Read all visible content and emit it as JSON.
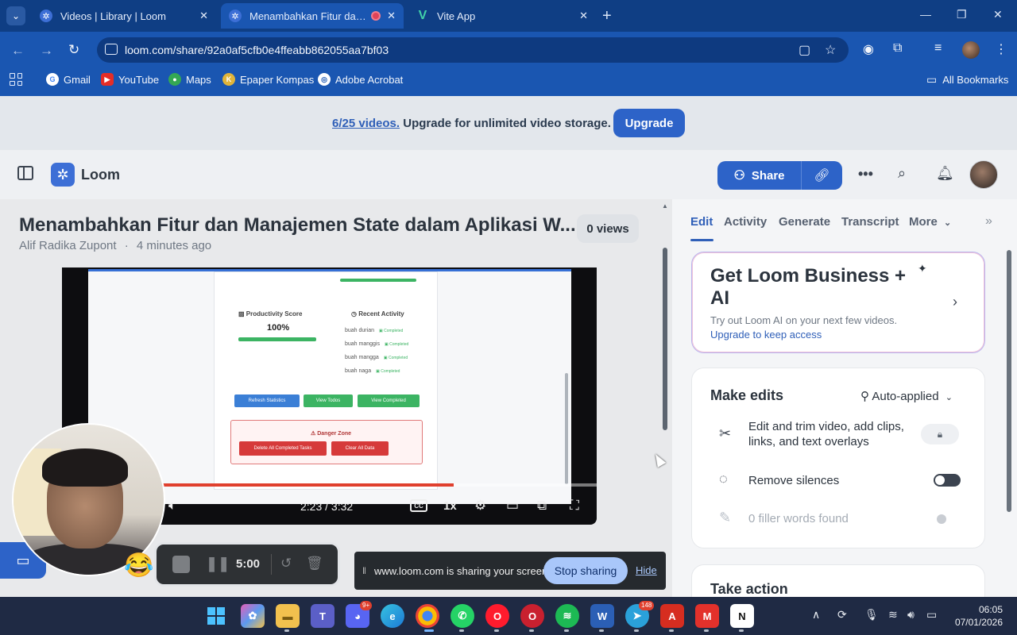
{
  "browser": {
    "tabs": [
      {
        "title": "Videos | Library | Loom",
        "active": false
      },
      {
        "title": "Menambahkan Fitur dan M",
        "active": true
      },
      {
        "title": "Vite App",
        "active": false
      }
    ],
    "url": "loom.com/share/92a0af5cfb0e4ffeabb862055aa7bf03",
    "bookmarks": [
      "Gmail",
      "YouTube",
      "Maps",
      "Epaper Kompas",
      "Adobe Acrobat"
    ],
    "all_bookmarks": "All Bookmarks"
  },
  "banner": {
    "link_text": "6/25 videos.",
    "text": "Upgrade for unlimited video storage.",
    "button": "Upgrade"
  },
  "header": {
    "logo": "Loom",
    "share_label": "Share"
  },
  "video": {
    "title": "Menambahkan Fitur dan Manajemen State dalam Aplikasi W...",
    "author": "Alif Radika Zupont",
    "age": "4 minutes ago",
    "views": "0 views",
    "time_display": "2:23 / 3:32",
    "progress": 0.674,
    "speed": "1x",
    "cc_label": "CC",
    "content": {
      "productivity_title": "Productivity Score",
      "productivity_value": "100%",
      "recent_title": "Recent Activity",
      "recent_items": [
        "buah durian",
        "buah manggis",
        "buah mangga",
        "buah naga"
      ],
      "recent_status": "Completed",
      "buttons": [
        "Refresh Statistics",
        "View Todos",
        "View Completed"
      ],
      "danger_title": "Danger Zone",
      "danger_buttons": [
        "Delete All Completed Tasks",
        "Clear All Data"
      ]
    }
  },
  "recorder": {
    "time": "5:00"
  },
  "screen_share": {
    "message": "www.loom.com is sharing your screen.",
    "stop_label": "Stop sharing",
    "hide_label": "Hide"
  },
  "panel": {
    "tabs": [
      "Edit",
      "Activity",
      "Generate",
      "Transcript",
      "More"
    ],
    "promo": {
      "title": "Get Loom Business + AI",
      "subtitle": "Try out Loom AI on your next few videos.",
      "link": "Upgrade to keep access"
    },
    "edits": {
      "title": "Make edits",
      "mode": "Auto-applied",
      "rows": [
        {
          "text": "Edit and trim video, add clips, links, and text overlays"
        },
        {
          "text": "Remove silences"
        },
        {
          "text": "0 filler words found"
        }
      ]
    },
    "take_action": "Take action"
  },
  "taskbar": {
    "badges": [
      "9+",
      "148"
    ],
    "time": "06:05",
    "date": "07/01/2026"
  },
  "colors": {
    "brand": "#2d63c8",
    "chrome": "#1a56b1",
    "progress": "#e0402e"
  }
}
